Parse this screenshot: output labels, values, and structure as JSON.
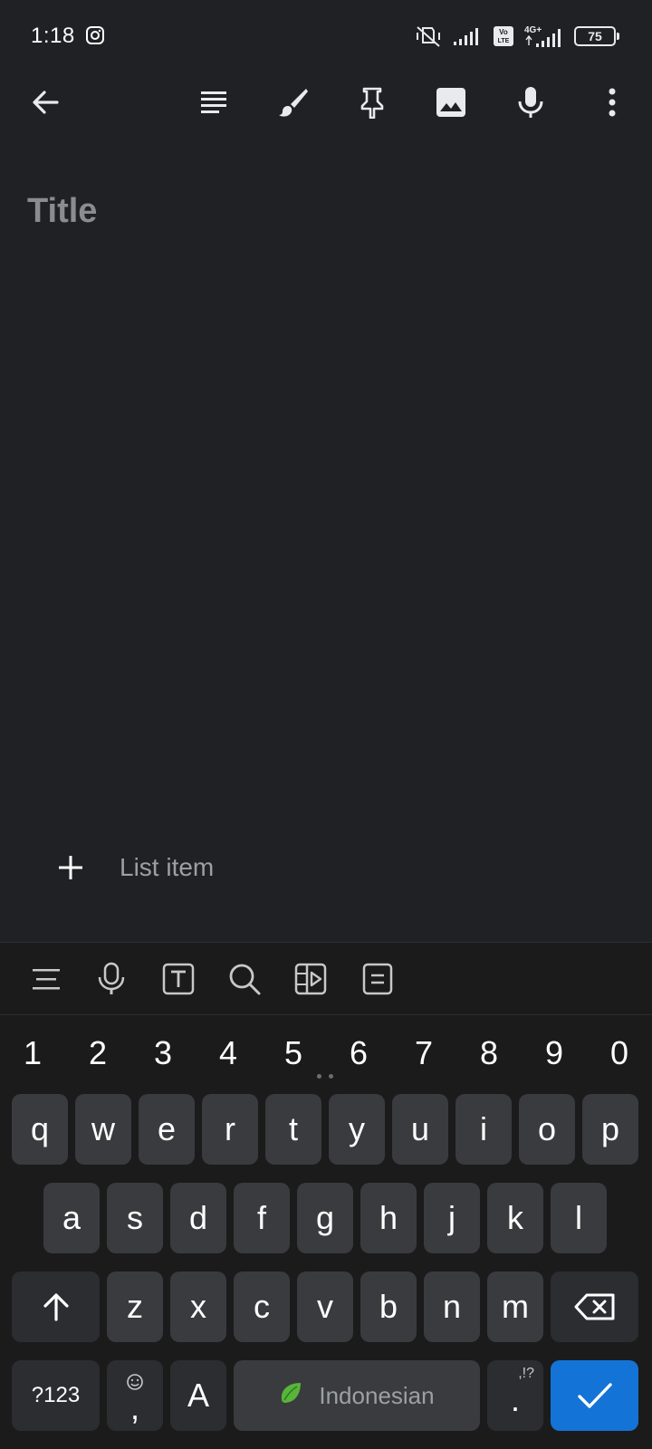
{
  "status_bar": {
    "time": "1:18",
    "battery_level": "75",
    "network_label": "4G+",
    "volte_label": "Vo LTE"
  },
  "toolbar": {
    "back_icon": "arrow-left-icon",
    "icons": [
      "text-format-icon",
      "brush-icon",
      "pin-icon",
      "image-icon",
      "mic-icon",
      "more-vert-icon"
    ]
  },
  "note": {
    "title_placeholder": "Title",
    "list_item_placeholder": "List item"
  },
  "keyboard": {
    "toolbar_icons": [
      "menu-icon",
      "mic-icon",
      "text-box-icon",
      "search-icon",
      "media-icon",
      "clipboard-icon"
    ],
    "number_row": [
      "1",
      "2",
      "3",
      "4",
      "5",
      "6",
      "7",
      "8",
      "9",
      "0"
    ],
    "row1": [
      "q",
      "w",
      "e",
      "r",
      "t",
      "y",
      "u",
      "i",
      "o",
      "p"
    ],
    "row2": [
      "a",
      "s",
      "d",
      "f",
      "g",
      "h",
      "j",
      "k",
      "l"
    ],
    "row3": [
      "z",
      "x",
      "c",
      "v",
      "b",
      "n",
      "m"
    ],
    "symbols_label": "?123",
    "comma_label": ",",
    "case_label": "A",
    "space_label": "Indonesian",
    "period_label": ".",
    "period_sub": ",!?",
    "accent_color": "#1473d6"
  }
}
